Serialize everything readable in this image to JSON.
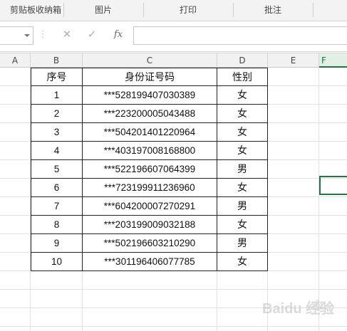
{
  "ribbon": {
    "groups": [
      "剪贴板收纳箱",
      "图片",
      "打印",
      "批注"
    ]
  },
  "formula_bar": {
    "name_box_value": "",
    "cancel_glyph": "✕",
    "enter_glyph": "✓",
    "fx_label": "fx",
    "formula_value": ""
  },
  "columns": [
    "A",
    "B",
    "C",
    "D",
    "E",
    "F"
  ],
  "table": {
    "headers": [
      "序号",
      "身份证号码",
      "性别"
    ],
    "rows": [
      [
        "1",
        "***528199407030389",
        "女"
      ],
      [
        "2",
        "***223200005043488",
        "女"
      ],
      [
        "3",
        "***504201401220964",
        "女"
      ],
      [
        "4",
        "***403197008168800",
        "女"
      ],
      [
        "5",
        "***522196607064399",
        "男"
      ],
      [
        "6",
        "***723199911236960",
        "女"
      ],
      [
        "7",
        "***604200007270291",
        "男"
      ],
      [
        "8",
        "***203199009032188",
        "女"
      ],
      [
        "9",
        "***502196603210290",
        "男"
      ],
      [
        "10",
        "***301196406077785",
        "女"
      ]
    ]
  },
  "colors": {
    "accent": "#217346",
    "grid": "#e1e1e1",
    "table_border": "#222222",
    "header_bg": "#f1f1f1"
  },
  "watermark": "Baidu 经验"
}
